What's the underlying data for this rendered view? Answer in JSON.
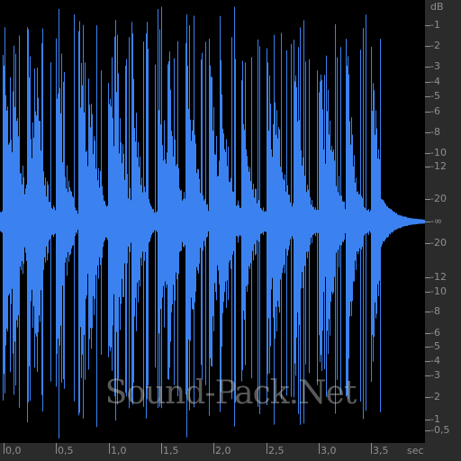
{
  "editor": {
    "waveform_color": "#3b82f0",
    "background_color": "#000000",
    "ruler_color": "#2b2b2b",
    "ruler_text_color": "#8f8f8f"
  },
  "db_ruler": {
    "unit": "dB",
    "labels": [
      "-1",
      "-2",
      "-3",
      "-4",
      "-5",
      "-6",
      "-8",
      "-10",
      "-12",
      "-20",
      "-∞",
      "-20",
      "-12",
      "-10",
      "-8",
      "-6",
      "-5",
      "-4",
      "-3",
      "-2",
      "-1",
      "-0,5"
    ]
  },
  "time_ruler": {
    "unit": "sec",
    "labels": [
      "0,0",
      "0,5",
      "1,0",
      "1,5",
      "2,0",
      "2,5",
      "3,0",
      "3,5"
    ]
  },
  "watermark": "Sound-Pack.Net"
}
